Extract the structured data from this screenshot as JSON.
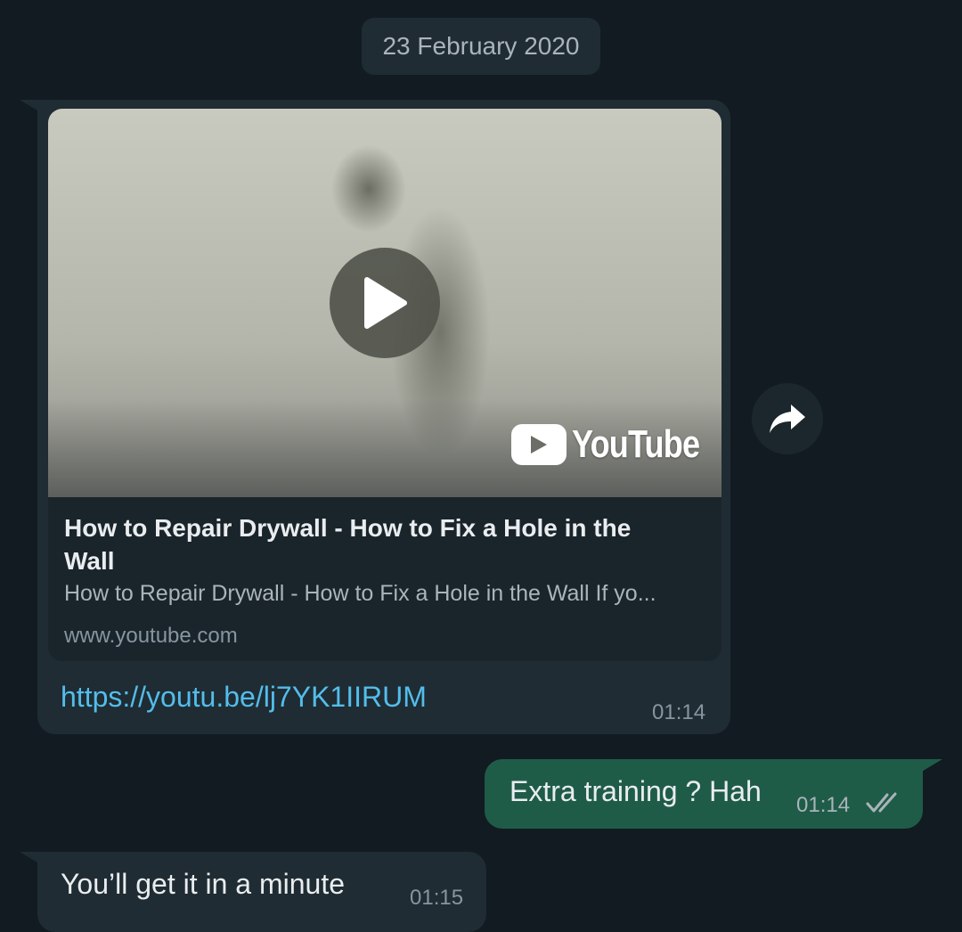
{
  "date_divider": "23 February 2020",
  "link_message": {
    "preview": {
      "provider": "YouTube",
      "title": "How to Repair Drywall - How to Fix a Hole in the Wall",
      "description": "How to Repair Drywall - How to Fix a Hole in the Wall If yo...",
      "domain": "www.youtube.com"
    },
    "url": "https://youtu.be/lj7YK1IIRUM",
    "time": "01:14"
  },
  "sent_message": {
    "text": "Extra training ? Hah",
    "time": "01:14",
    "status": "read"
  },
  "received_message": {
    "text": "You’ll get it in a minute",
    "time": "01:15"
  },
  "icons": {
    "play": "play-icon",
    "youtube": "youtube-logo-icon",
    "forward": "forward-icon",
    "read_receipt": "double-check-icon"
  },
  "colors": {
    "background": "#121b22",
    "incoming_bubble": "#1f2c33",
    "outgoing_bubble": "#1f5c48",
    "link": "#53bdeb",
    "read_ticks": "#aab4ba"
  }
}
